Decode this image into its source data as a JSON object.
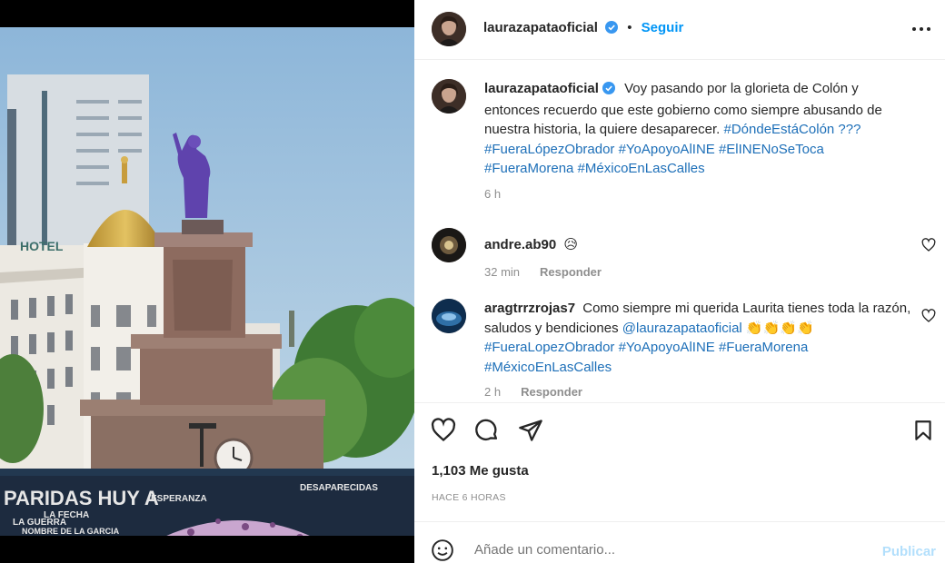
{
  "post": {
    "author": "laurazapataoficial",
    "follow_label": "Seguir",
    "separator": "•",
    "caption_text": "Voy pasando por la glorieta de Colón y entonces recuerdo que este gobierno como siempre abusando de nuestra historia, la quiere desaparecer.",
    "caption_tags": "#DóndeEstáColón ??? #FueraLópezObrador #YoApoyoAlINE #ElINENoSeToca #FueraMorena #MéxicoEnLasCalles",
    "caption_age": "6 h",
    "likes": "1,103 Me gusta",
    "timestamp": "HACE 6 HORAS"
  },
  "photo": {
    "hotel_sign": "HOTEL",
    "banner_lines": [
      "PARIDAS HUY A",
      "ESPERANZA",
      "LA FECHA",
      "LA GUERRA",
      "DESAPARECIDAS",
      "NOMBRE DE LA GARCIA"
    ]
  },
  "comments": [
    {
      "user": "andre.ab90",
      "text": "",
      "emoji": "😥",
      "age": "32 min",
      "reply": "Responder"
    },
    {
      "user": "aragtrrzrojas7",
      "text": "Como siempre mi querida Laurita tienes toda la razón, saludos y bendiciones",
      "mention": "@laurazapataoficial",
      "emoji": "👏👏👏👏",
      "tags": "#FueraLopezObrador #YoApoyoAlINE #FueraMorena #MéxicoEnLasCalles",
      "age": "2 h",
      "reply": "Responder"
    }
  ],
  "composer": {
    "placeholder": "Añade un comentario...",
    "publish_label": "Publicar"
  },
  "colors": {
    "accent": "#0095f6",
    "hashtag": "#1d6fb8",
    "muted": "#8e8e8e",
    "publish_disabled": "#b2dffc",
    "verified": "#3897f0"
  },
  "icons": [
    "verified-badge-icon",
    "more-options-icon",
    "heart-icon",
    "comment-icon",
    "share-icon",
    "bookmark-icon",
    "emoji-icon"
  ]
}
